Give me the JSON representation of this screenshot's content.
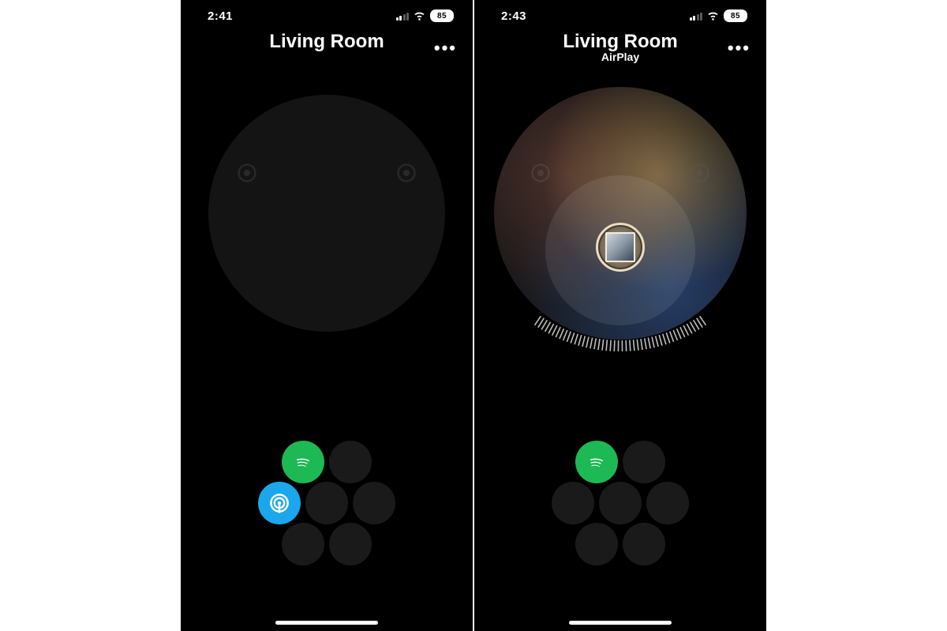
{
  "left": {
    "status": {
      "time": "2:41",
      "battery": "85"
    },
    "header": {
      "title": "Living Room",
      "subtitle": ""
    },
    "more": "•••",
    "cluster": {
      "top_l": {
        "kind": "spotify"
      },
      "top_r": {
        "kind": "empty"
      },
      "mid_l": {
        "kind": "airplay"
      },
      "mid_c": {
        "kind": "empty"
      },
      "mid_r": {
        "kind": "empty"
      },
      "bot_l": {
        "kind": "empty"
      },
      "bot_r": {
        "kind": "empty"
      }
    }
  },
  "right": {
    "status": {
      "time": "2:43",
      "battery": "85"
    },
    "header": {
      "title": "Living Room",
      "subtitle": "AirPlay"
    },
    "more": "•••",
    "cluster": {
      "top_l": {
        "kind": "spotify"
      },
      "top_r": {
        "kind": "empty"
      },
      "mid_l": {
        "kind": "empty"
      },
      "mid_c": {
        "kind": "empty"
      },
      "mid_r": {
        "kind": "empty"
      },
      "bot_l": {
        "kind": "empty"
      },
      "bot_r": {
        "kind": "empty"
      }
    }
  }
}
